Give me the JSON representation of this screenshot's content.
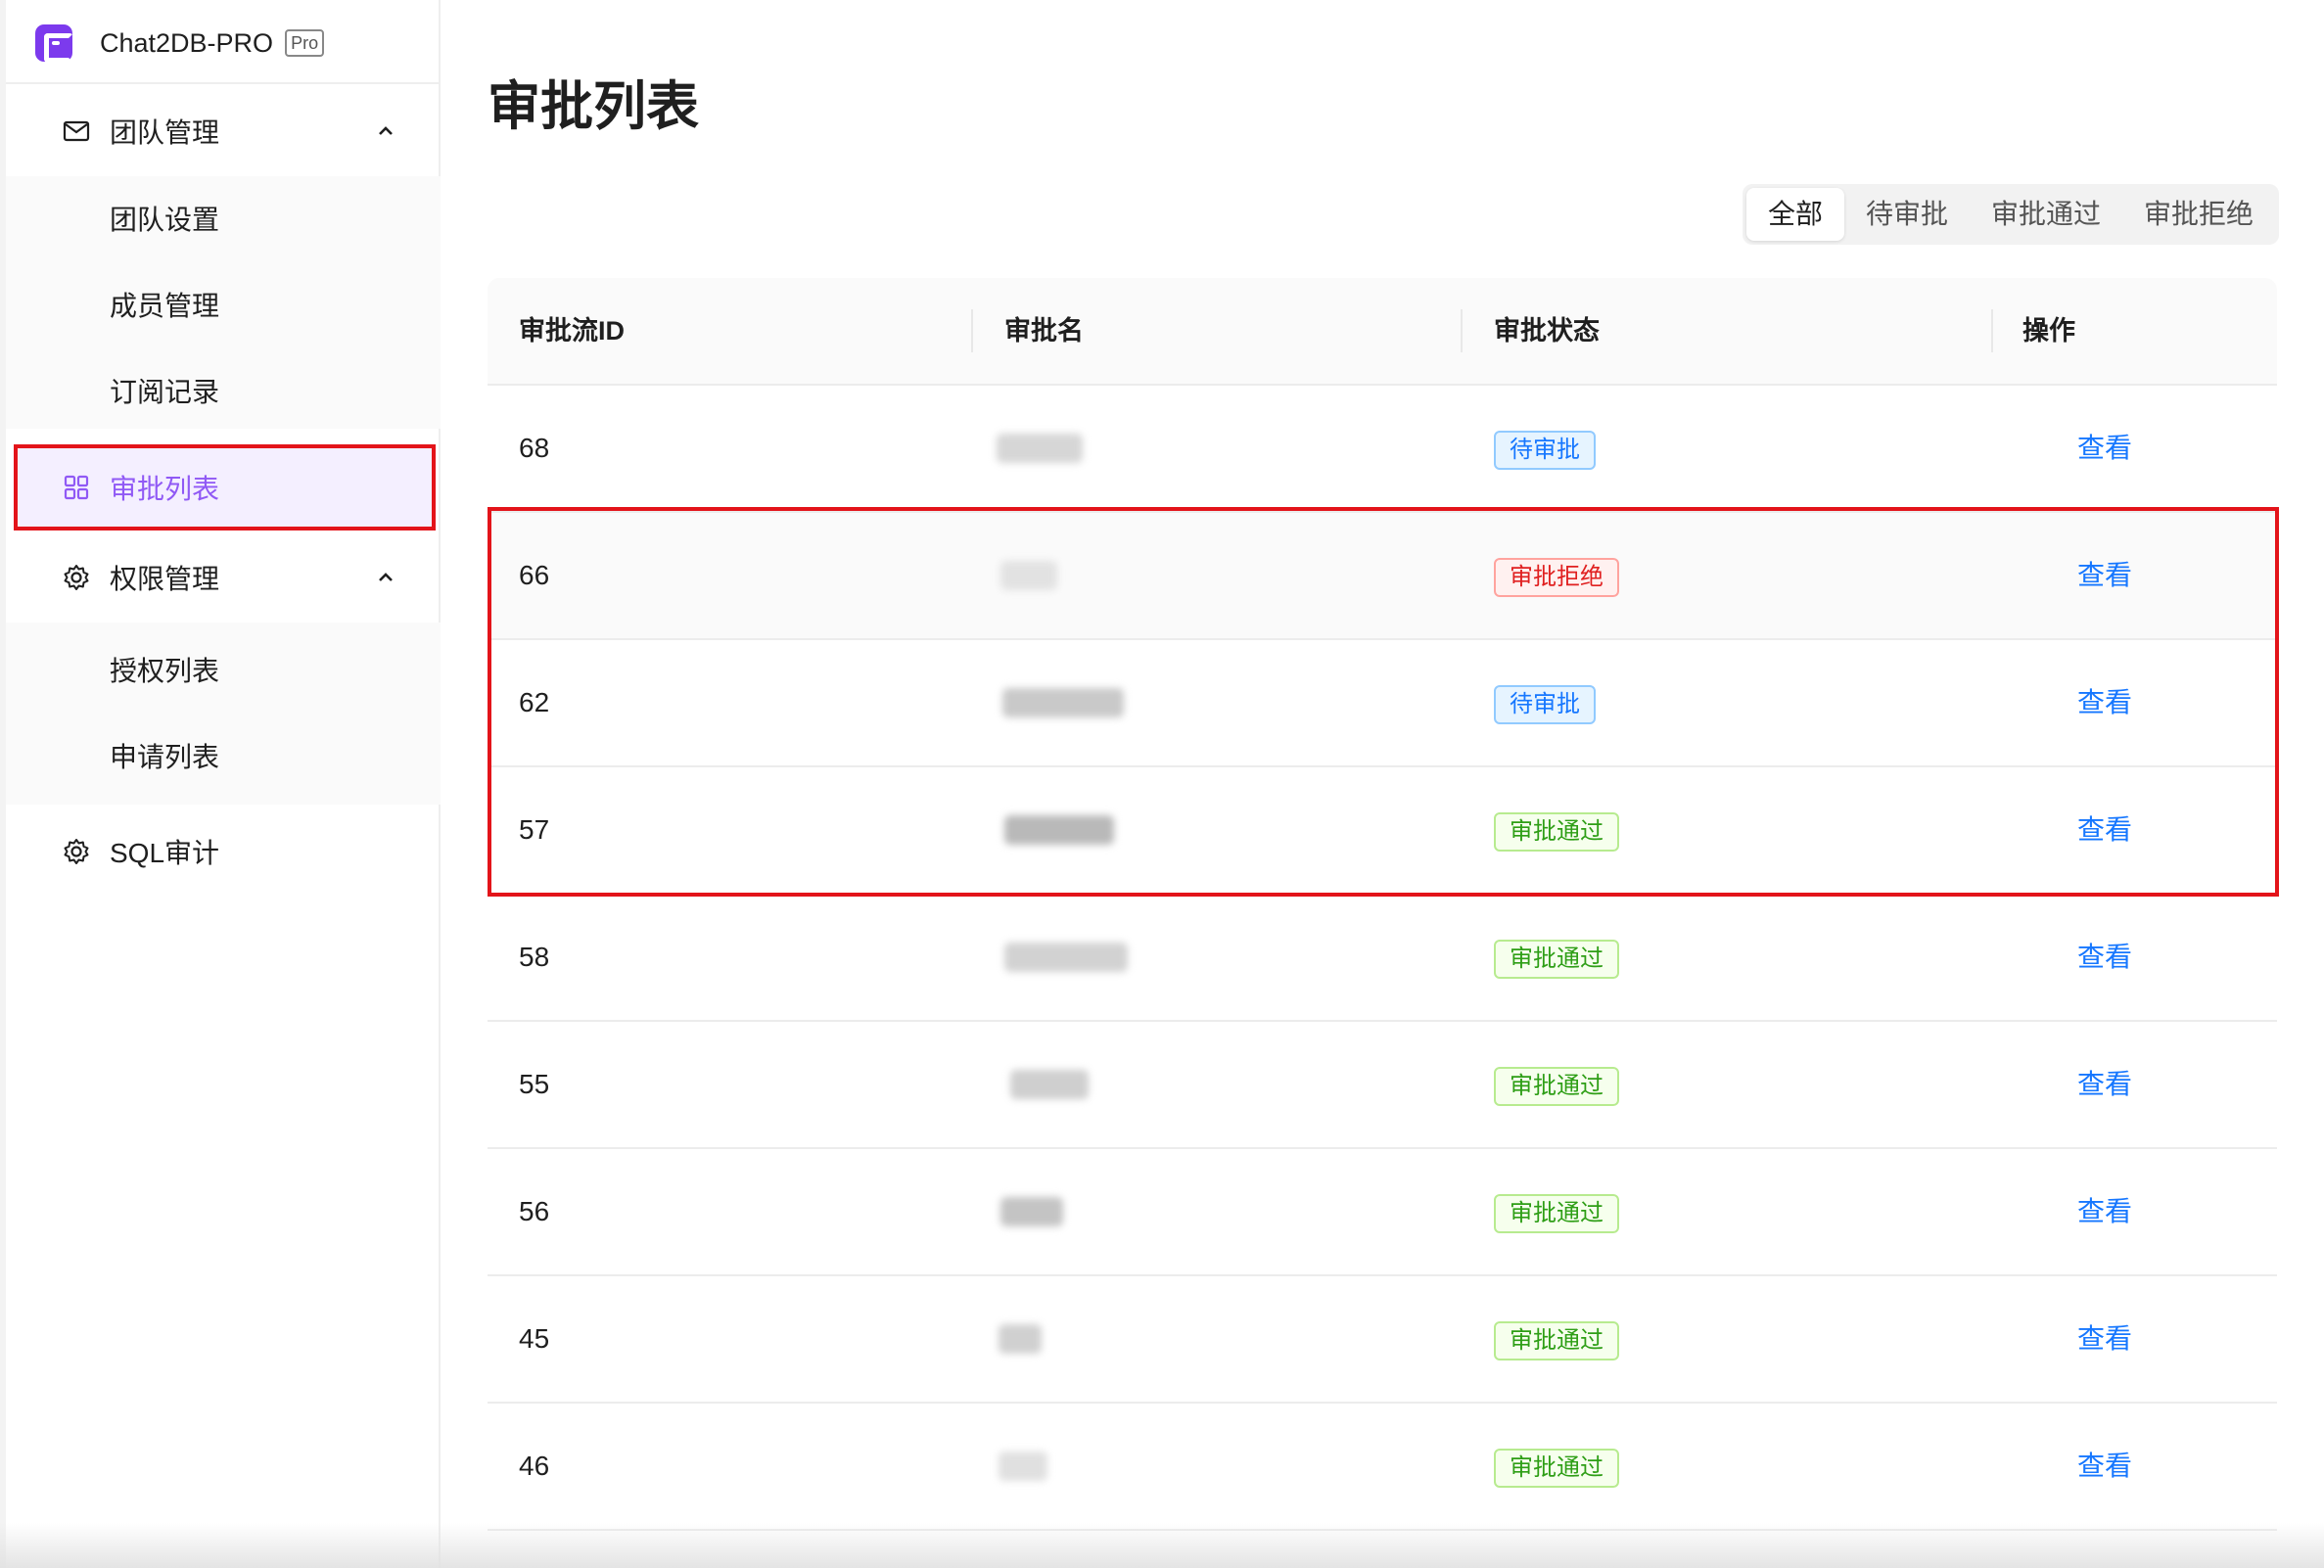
{
  "brand": {
    "name": "Chat2DB-PRO",
    "badge": "Pro"
  },
  "sidebar": {
    "team_group": {
      "label": "团队管理"
    },
    "team_items": [
      "团队设置",
      "成员管理",
      "订阅记录"
    ],
    "approval_item": {
      "label": "审批列表"
    },
    "perm_group": {
      "label": "权限管理"
    },
    "perm_items": [
      "授权列表",
      "申请列表"
    ],
    "audit_item": {
      "label": "SQL审计"
    }
  },
  "page": {
    "title": "审批列表"
  },
  "filter_tabs": {
    "items": [
      "全部",
      "待审批",
      "审批通过",
      "审批拒绝"
    ],
    "selected": "全部"
  },
  "table": {
    "headers": {
      "id": "审批流ID",
      "name": "审批名",
      "status": "审批状态",
      "action": "操作"
    },
    "rows": [
      {
        "id": "68",
        "status": "待审批",
        "status_type": "pending",
        "action": "查看"
      },
      {
        "id": "66",
        "status": "审批拒绝",
        "status_type": "rejected",
        "action": "查看"
      },
      {
        "id": "62",
        "status": "待审批",
        "status_type": "pending",
        "action": "查看"
      },
      {
        "id": "57",
        "status": "审批通过",
        "status_type": "approved",
        "action": "查看"
      },
      {
        "id": "58",
        "status": "审批通过",
        "status_type": "approved",
        "action": "查看"
      },
      {
        "id": "55",
        "status": "审批通过",
        "status_type": "approved",
        "action": "查看"
      },
      {
        "id": "56",
        "status": "审批通过",
        "status_type": "approved",
        "action": "查看"
      },
      {
        "id": "45",
        "status": "审批通过",
        "status_type": "approved",
        "action": "查看"
      },
      {
        "id": "46",
        "status": "审批通过",
        "status_type": "approved",
        "action": "查看"
      }
    ]
  },
  "colors": {
    "brand": "#7c3aed",
    "active_menu_text": "#9059f5",
    "link": "#1677ff",
    "annotation_red": "#e3141a",
    "pending": "#1677ff",
    "rejected": "#e02020",
    "approved": "#2e9e16"
  },
  "icons": {
    "team_group": "mail-icon",
    "approval_item": "grid-icon",
    "perm_group": "gear-icon",
    "audit_item": "gear-icon",
    "expand": "chevron-up-icon"
  }
}
